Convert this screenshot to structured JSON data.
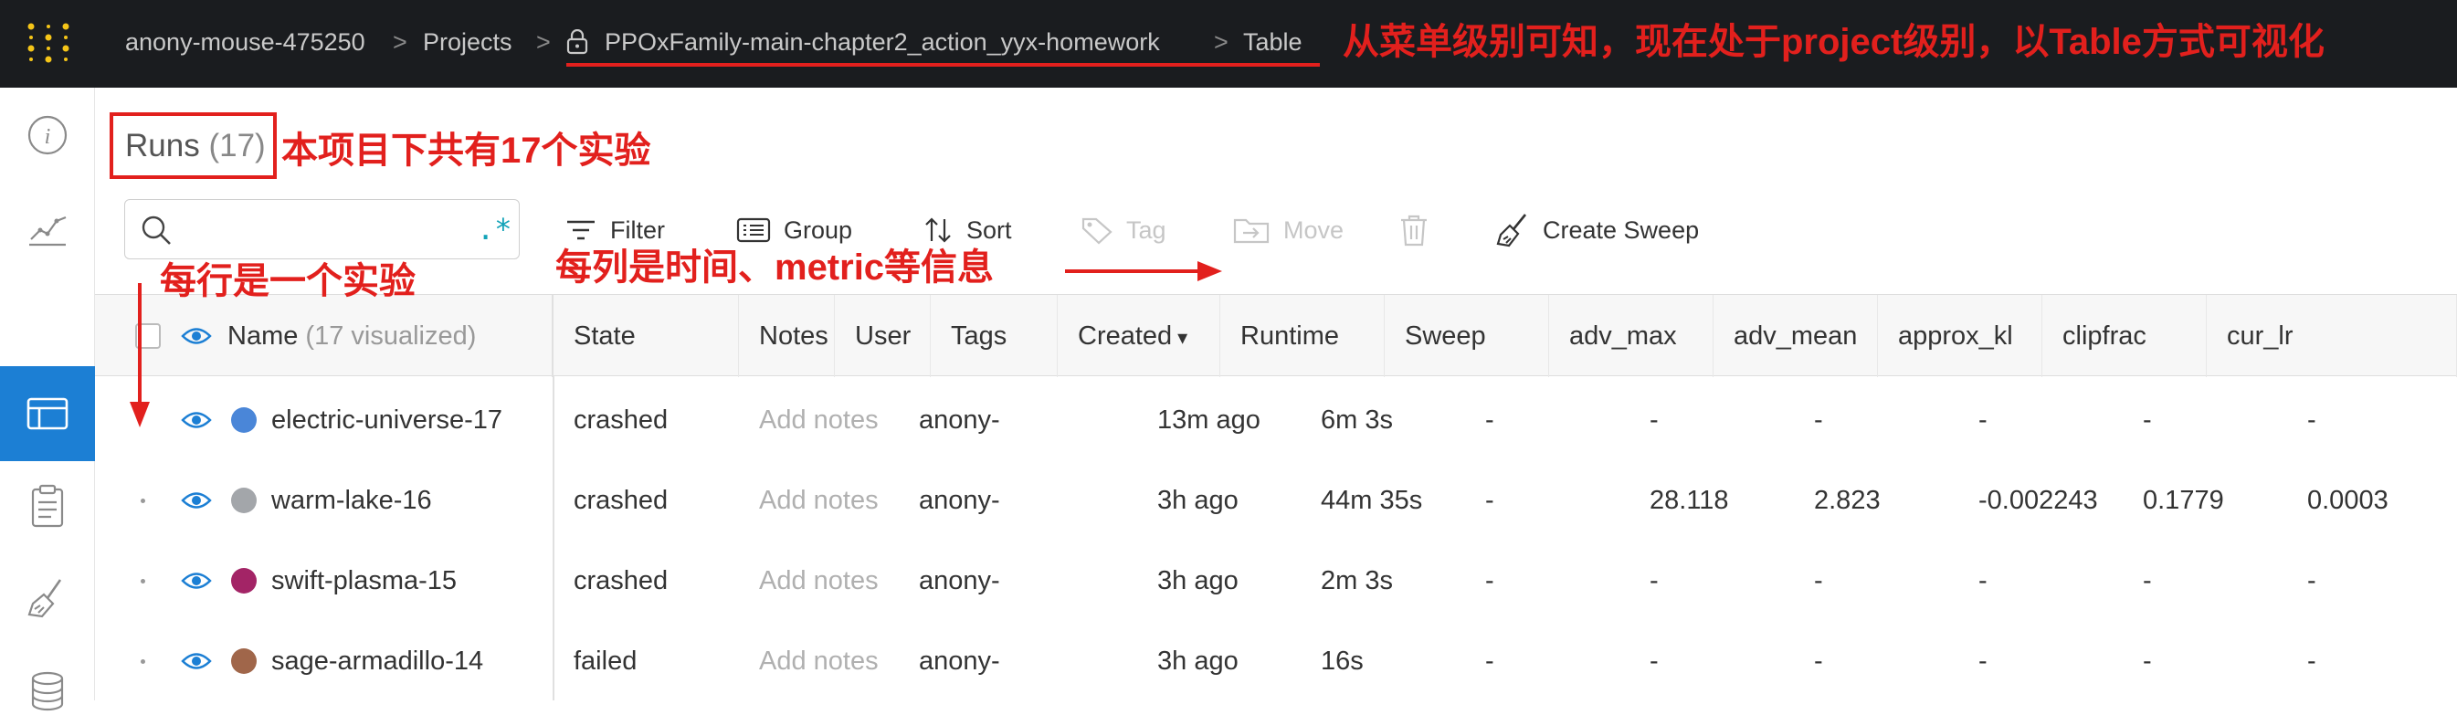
{
  "topbar": {
    "breadcrumbs": [
      "anony-mouse-475250",
      "Projects",
      "PPOxFamily-main-chapter2_action_yyx-homework",
      "Table"
    ],
    "separator": ">",
    "annotation": "从菜单级别可知，现在处于project级别，以Table方式可视化"
  },
  "sidebar": {
    "items": [
      "info-icon",
      "charts-icon",
      "table-icon",
      "report-icon",
      "sweep-icon",
      "artifacts-icon"
    ],
    "active": "table-icon"
  },
  "runs": {
    "title": "Runs",
    "count": "(17)",
    "annotation": "本项目下共有17个实验"
  },
  "search": {
    "placeholder": "",
    "regex_symbol": ".*"
  },
  "toolbar": {
    "filter": "Filter",
    "group": "Group",
    "sort": "Sort",
    "tag": "Tag",
    "move": "Move",
    "create_sweep": "Create Sweep"
  },
  "annotations": {
    "rows": "每行是一个实验",
    "columns": "每列是时间、metric等信息"
  },
  "table": {
    "name_header": "Name",
    "name_header_sub": "(17 visualized)",
    "columns": [
      "State",
      "Notes",
      "User",
      "Tags",
      "Created",
      "Runtime",
      "Sweep",
      "adv_max",
      "adv_mean",
      "approx_kl",
      "clipfrac",
      "cur_lr"
    ],
    "sorted_column": "Created",
    "sort_arrow": "▾",
    "rows": [
      {
        "name": "electric-universe-17",
        "color": "#4a86d8",
        "state": "crashed",
        "notes": "Add notes",
        "user": "anony-",
        "tags": "",
        "created": "13m ago",
        "runtime": "6m 3s",
        "sweep": "-",
        "adv_max": "-",
        "adv_mean": "-",
        "approx_kl": "-",
        "clipfrac": "-",
        "cur_lr": "-"
      },
      {
        "name": "warm-lake-16",
        "color": "#a3a6aa",
        "state": "crashed",
        "notes": "Add notes",
        "user": "anony-",
        "tags": "",
        "created": "3h ago",
        "runtime": "44m 35s",
        "sweep": "-",
        "adv_max": "28.118",
        "adv_mean": "2.823",
        "approx_kl": "-0.002243",
        "clipfrac": "0.1779",
        "cur_lr": "0.0003"
      },
      {
        "name": "swift-plasma-15",
        "color": "#a32466",
        "state": "crashed",
        "notes": "Add notes",
        "user": "anony-",
        "tags": "",
        "created": "3h ago",
        "runtime": "2m 3s",
        "sweep": "-",
        "adv_max": "-",
        "adv_mean": "-",
        "approx_kl": "-",
        "clipfrac": "-",
        "cur_lr": "-"
      },
      {
        "name": "sage-armadillo-14",
        "color": "#a0664a",
        "state": "failed",
        "notes": "Add notes",
        "user": "anony-",
        "tags": "",
        "created": "3h ago",
        "runtime": "16s",
        "sweep": "-",
        "adv_max": "-",
        "adv_mean": "-",
        "approx_kl": "-",
        "clipfrac": "-",
        "cur_lr": "-"
      }
    ]
  },
  "colors": {
    "accent": "#1c7fd4",
    "annotation_red": "#e2201d",
    "topbar_bg": "#1a1c1f",
    "logo": "#f5c518"
  }
}
